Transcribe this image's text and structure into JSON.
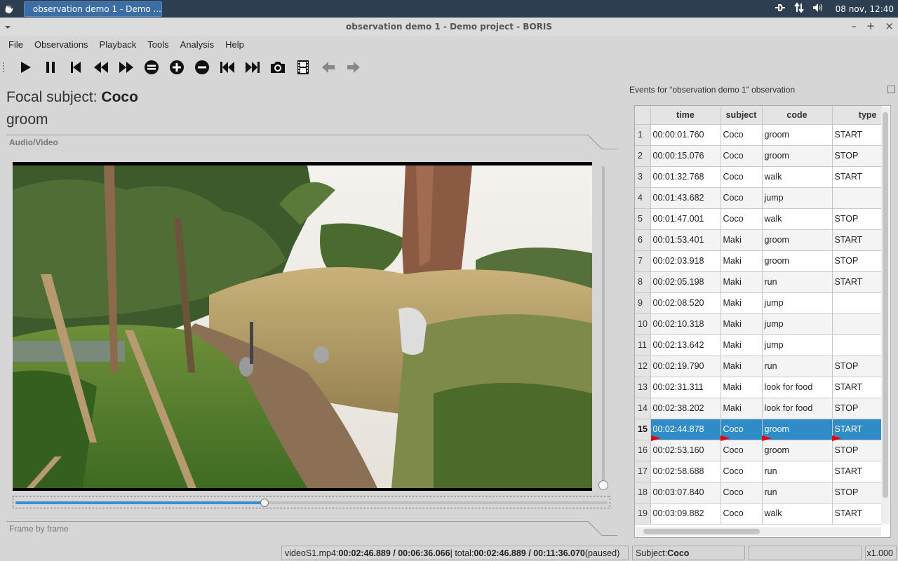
{
  "taskbar": {
    "window_title": "observation demo 1 - Demo ...",
    "clock": "08 nov, 12:40"
  },
  "titlebar": {
    "title": "observation demo 1 - Demo project - BORIS"
  },
  "menu": [
    "File",
    "Observations",
    "Playback",
    "Tools",
    "Analysis",
    "Help"
  ],
  "toolbar": {
    "icons": [
      "play-icon",
      "pause-icon",
      "skip-start-icon",
      "rewind-icon",
      "fast-forward-icon",
      "equal-speed-icon",
      "speed-up-icon",
      "speed-down-icon",
      "previous-media-icon",
      "next-media-icon",
      "camera-icon",
      "film-icon",
      "back-arrow-icon",
      "forward-arrow-icon"
    ]
  },
  "focal": {
    "prefix": "Focal subject: ",
    "subject": "Coco",
    "state": "groom"
  },
  "groups": {
    "audio_video": "Audio/Video",
    "frame_by_frame": "Frame by frame"
  },
  "player": {
    "position_fraction": 0.4207
  },
  "events_dock": {
    "title": "Events for “observation demo 1” observation",
    "columns": [
      "time",
      "subject",
      "code",
      "type"
    ],
    "rows": [
      {
        "n": "1",
        "time": "00:00:01.760",
        "subject": "Coco",
        "code": "groom",
        "type": "START"
      },
      {
        "n": "2",
        "time": "00:00:15.076",
        "subject": "Coco",
        "code": "groom",
        "type": "STOP"
      },
      {
        "n": "3",
        "time": "00:01:32.768",
        "subject": "Coco",
        "code": "walk",
        "type": "START"
      },
      {
        "n": "4",
        "time": "00:01:43.682",
        "subject": "Coco",
        "code": "jump",
        "type": ""
      },
      {
        "n": "5",
        "time": "00:01:47.001",
        "subject": "Coco",
        "code": "walk",
        "type": "STOP"
      },
      {
        "n": "6",
        "time": "00:01:53.401",
        "subject": "Maki",
        "code": "groom",
        "type": "START"
      },
      {
        "n": "7",
        "time": "00:02:03.918",
        "subject": "Maki",
        "code": "groom",
        "type": "STOP"
      },
      {
        "n": "8",
        "time": "00:02:05.198",
        "subject": "Maki",
        "code": "run",
        "type": "START"
      },
      {
        "n": "9",
        "time": "00:02:08.520",
        "subject": "Maki",
        "code": "jump",
        "type": ""
      },
      {
        "n": "10",
        "time": "00:02:10.318",
        "subject": "Maki",
        "code": "jump",
        "type": ""
      },
      {
        "n": "11",
        "time": "00:02:13.642",
        "subject": "Maki",
        "code": "jump",
        "type": ""
      },
      {
        "n": "12",
        "time": "00:02:19.790",
        "subject": "Maki",
        "code": "run",
        "type": "STOP"
      },
      {
        "n": "13",
        "time": "00:02:31.311",
        "subject": "Maki",
        "code": "look for food",
        "type": "START"
      },
      {
        "n": "14",
        "time": "00:02:38.202",
        "subject": "Maki",
        "code": "look for food",
        "type": "STOP"
      },
      {
        "n": "15",
        "time": "00:02:44.878",
        "subject": "Coco",
        "code": "groom",
        "type": "START"
      },
      {
        "n": "16",
        "time": "00:02:53.160",
        "subject": "Coco",
        "code": "groom",
        "type": "STOP"
      },
      {
        "n": "17",
        "time": "00:02:58.688",
        "subject": "Coco",
        "code": "run",
        "type": "START"
      },
      {
        "n": "18",
        "time": "00:03:07.840",
        "subject": "Coco",
        "code": "run",
        "type": "STOP"
      },
      {
        "n": "19",
        "time": "00:03:09.882",
        "subject": "Coco",
        "code": "walk",
        "type": "START"
      }
    ],
    "selected_row": "15"
  },
  "status": {
    "media_prefix": "videoS1.mp4: ",
    "media_pos": "00:02:46.889 / 00:06:36.066",
    "total_prefix": " | total: ",
    "total_pos": "00:02:46.889 / 00:11:36.070",
    "state": " (paused)",
    "subject_prefix": "Subject: ",
    "subject": "Coco",
    "speed": "x1.000"
  }
}
